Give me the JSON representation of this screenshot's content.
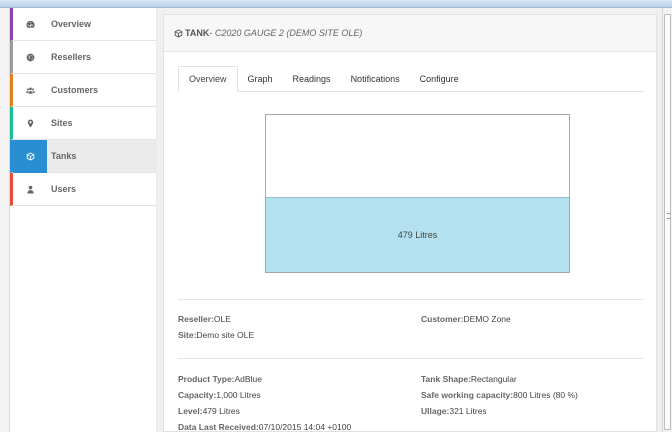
{
  "sidebar": {
    "items": [
      {
        "label": "Overview",
        "icon": "dashboard-icon",
        "accent": "#8e44ad"
      },
      {
        "label": "Resellers",
        "icon": "globe-icon",
        "accent": "#9b9b9b"
      },
      {
        "label": "Customers",
        "icon": "users-icon",
        "accent": "#e67e22"
      },
      {
        "label": "Sites",
        "icon": "map-marker-icon",
        "accent": "#1abc9c"
      },
      {
        "label": "Tanks",
        "icon": "cube-icon",
        "accent": "#2a8fd2",
        "active": true
      },
      {
        "label": "Users",
        "icon": "user-icon",
        "accent": "#e74c3c"
      }
    ]
  },
  "header": {
    "title": "TANK",
    "subtitle": " - C2020 GAUGE 2 (DEMO SITE OLE)",
    "icon": "cube-icon"
  },
  "tabs": [
    "Overview",
    "Graph",
    "Readings",
    "Notifications",
    "Configure"
  ],
  "active_tab": "Overview",
  "gauge": {
    "label": "479 Litres",
    "fill_fraction": 0.479,
    "fill_color": "#b3e1ef"
  },
  "details": {
    "reseller_key": "Reseller:",
    "reseller_val": "OLE",
    "customer_key": "Customer:",
    "customer_val": "DEMO Zone",
    "site_key": "Site:",
    "site_val": "Demo site OLE",
    "product_type_key": "Product Type:",
    "product_type_val": "AdBlue",
    "tank_shape_key": "Tank Shape:",
    "tank_shape_val": "Rectangular",
    "capacity_key": "Capacity:",
    "capacity_val": "1,000 Litres",
    "safe_capacity_key": "Safe working capacity:",
    "safe_capacity_val": "800 Litres (80 %)",
    "level_key": "Level:",
    "level_val": "479 Litres",
    "ullage_key": "Ullage:",
    "ullage_val": "321 Litres",
    "last_received_key": "Data Last Received:",
    "last_received_val": "07/10/2015 14:04 +0100"
  },
  "colors": {
    "active_blue": "#2a8fd2"
  }
}
